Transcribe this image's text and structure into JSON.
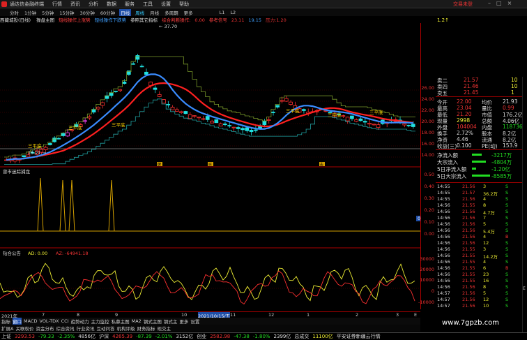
{
  "app": {
    "title": "通达信金融终端",
    "menu": [
      "行情",
      "资讯",
      "分析",
      "数据",
      "服务",
      "工具",
      "设置",
      "帮助"
    ],
    "right_label": "交易未登",
    "window_controls": [
      "–",
      "□",
      "×"
    ]
  },
  "toolbar": {
    "periods": [
      "分时",
      "1分钟",
      "5分钟",
      "15分钟",
      "30分钟",
      "60分钟",
      "日线",
      "周线",
      "月线",
      "多周期",
      "更多"
    ],
    "selected": "日线",
    "extra": [
      "多周期"
    ],
    "tools": [
      "L1",
      "L2"
    ]
  },
  "chart_header": {
    "stock": "西藏城投(日线)",
    "items": [
      {
        "text": "操盘主图",
        "color": "#dddddd"
      },
      {
        "text": "短线操作上涨势",
        "color": "#ff4040"
      },
      {
        "text": "短线操作下跌势",
        "color": "#40a0ff"
      },
      {
        "text": "参照其它指标",
        "color": "#dddddd"
      },
      {
        "text": "综合判断操作:",
        "color": "#ff4040"
      },
      {
        "text": "0.00",
        "color": "#ee3333"
      },
      {
        "text": "参考信号",
        "color": "#ff4040"
      },
      {
        "text": "23.11",
        "color": "#ee3333"
      },
      {
        "text": "19.15",
        "color": "#40a0ff"
      },
      {
        "text": "压力:1.20",
        "color": "#ee3333"
      }
    ]
  },
  "price_axis": {
    "ticks": [
      "26.00",
      "24.00",
      "22.00",
      "20.00",
      "18.00",
      "16.00",
      "14.00"
    ],
    "max_label": "37.70",
    "min_label": "15.21",
    "right_small": "1.2↑"
  },
  "indicator1": {
    "name": "曾市迷踪捕龙",
    "value_label": "0.39",
    "ticks": [
      "0.50",
      "0.40",
      "0.30",
      "0.20",
      "0.10",
      "0.00"
    ]
  },
  "indicator2": {
    "name": "钻合公告",
    "ad_label": "AD: 0.00",
    "az_label": "AZ: -64941.18",
    "ticks": [
      "30000",
      "20000",
      "10000",
      "0",
      "-10000"
    ]
  },
  "signals": {
    "buy_label": "买",
    "hold_label": "三平底",
    "tags": [
      "牌",
      "买",
      "击"
    ]
  },
  "date_axis": [
    "2021年",
    "7",
    "8",
    "9",
    "10",
    "2021/10/15/五",
    "11",
    "12",
    "1",
    "2",
    "3",
    "E"
  ],
  "bottom_tabs": [
    "指标",
    "窗口",
    "MACD",
    "VOL-TDX",
    "CCI",
    "趋势动力",
    "主力监控",
    "私募主图",
    "MA2",
    "钢式主图",
    "钢式主",
    "更多",
    "设置"
  ],
  "bottom_tabs2": [
    "扩展A",
    "关联权价",
    "资金分布",
    "综合资讯",
    "行业资讯",
    "互动问答",
    "机构评级",
    "财务指标",
    "现交主"
  ],
  "quote": {
    "rows": [
      {
        "label": "卖二",
        "price": "21.57",
        "vol": "10"
      },
      {
        "label": "卖四",
        "price": "21.46",
        "vol": "10"
      },
      {
        "label": "卖五",
        "price": "21.45",
        "vol": "1"
      }
    ],
    "stats": [
      {
        "l1": "今开",
        "v1": "22.00",
        "l2": "均价",
        "v2": "21.93"
      },
      {
        "l1": "最高",
        "v1": "23.04",
        "l2": "量比",
        "v2": "0.99"
      },
      {
        "l1": "最低",
        "v1": "21.20",
        "l2": "市值",
        "v2": "176.2亿"
      },
      {
        "l1": "现量",
        "v1": "2998",
        "l2": "总额",
        "v2": "4.06亿"
      },
      {
        "l1": "外盘",
        "v1": "104004",
        "l2": "内盘",
        "v2": "118736"
      },
      {
        "l1": "换手",
        "v1": "2.72%",
        "l2": "股本",
        "v2": "8.2亿"
      },
      {
        "l1": "净资",
        "v1": "4.46",
        "l2": "流通",
        "v2": "8.2亿"
      },
      {
        "l1": "收益(三)",
        "v1": "0.100",
        "l2": "PE(动)",
        "v2": "153.9"
      }
    ],
    "flows": [
      {
        "label": "净流入额",
        "value": "-3217万",
        "color": "#2d2"
      },
      {
        "label": "大宗流入",
        "value": "-4804万",
        "color": "#2d2"
      },
      {
        "label": "5日净流入额",
        "value": "-1.20亿",
        "color": "#2d2"
      },
      {
        "label": "5日大宗流入",
        "value": "-8585万",
        "color": "#2d2"
      }
    ]
  },
  "ticks": [
    {
      "t": "14:55",
      "p": "21.56",
      "v": "3",
      "s": "S"
    },
    {
      "t": "14:55",
      "p": "21.57",
      "v": "36.2万",
      "s": "S"
    },
    {
      "t": "14:55",
      "p": "21.56",
      "v": "4",
      "s": "S"
    },
    {
      "t": "14:56",
      "p": "21.55",
      "v": "8",
      "s": "S"
    },
    {
      "t": "14:56",
      "p": "21.56",
      "v": "4.7万",
      "s": "S"
    },
    {
      "t": "14:56",
      "p": "21.56",
      "v": "7",
      "s": "S"
    },
    {
      "t": "14:56",
      "p": "21.56",
      "v": "5",
      "s": "S"
    },
    {
      "t": "14:56",
      "p": "21.56",
      "v": "5.4万",
      "s": "S"
    },
    {
      "t": "14:56",
      "p": "21.56",
      "v": "4",
      "s": "B"
    },
    {
      "t": "14:56",
      "p": "21.56",
      "v": "12",
      "s": "S"
    },
    {
      "t": "14:56",
      "p": "21.55",
      "v": "3",
      "s": "S"
    },
    {
      "t": "14:56",
      "p": "21.55",
      "v": "14.2万",
      "s": "S"
    },
    {
      "t": "14:56",
      "p": "21.55",
      "v": "4",
      "s": "S"
    },
    {
      "t": "14:56",
      "p": "21.55",
      "v": "6",
      "s": "B"
    },
    {
      "t": "14:56",
      "p": "21.55",
      "v": "23",
      "s": "S"
    },
    {
      "t": "14:56",
      "p": "21.55",
      "v": "16",
      "s": "S"
    },
    {
      "t": "14:56",
      "p": "21.56",
      "v": "8",
      "s": "S"
    },
    {
      "t": "14:57",
      "p": "21.56",
      "v": "5",
      "s": "S"
    },
    {
      "t": "14:57",
      "p": "21.56",
      "v": "12",
      "s": "S"
    },
    {
      "t": "14:57",
      "p": "21.56",
      "v": "10",
      "s": "S"
    }
  ],
  "status": {
    "items": [
      {
        "text": "上证",
        "c": "w"
      },
      {
        "text": "3293.53",
        "c": "r"
      },
      {
        "text": "-79.33",
        "c": "g"
      },
      {
        "text": "-2.35%",
        "c": "g"
      },
      {
        "text": "4856亿",
        "c": "w"
      },
      {
        "text": "沪深",
        "c": "w"
      },
      {
        "text": "4265.39",
        "c": "r"
      },
      {
        "text": "-87.39",
        "c": "g"
      },
      {
        "text": "-2.01%",
        "c": "g"
      },
      {
        "text": "3152亿",
        "c": "w"
      },
      {
        "text": "创业",
        "c": "w"
      },
      {
        "text": "2582.98",
        "c": "r"
      },
      {
        "text": "-47.38",
        "c": "g"
      },
      {
        "text": "-1.80%",
        "c": "g"
      },
      {
        "text": "2399亿",
        "c": "w"
      },
      {
        "text": "总成交",
        "c": "w"
      },
      {
        "text": "11100亿",
        "c": "y"
      },
      {
        "text": "平安证券新疆云行情",
        "c": "w"
      }
    ]
  },
  "watermark": "www.7gpzb.com",
  "colors": {
    "up": "#ff3030",
    "down": "#20e0e0",
    "ma_red": "#ff2020",
    "ma_blue": "#3a8cff",
    "bg": "#000000"
  }
}
